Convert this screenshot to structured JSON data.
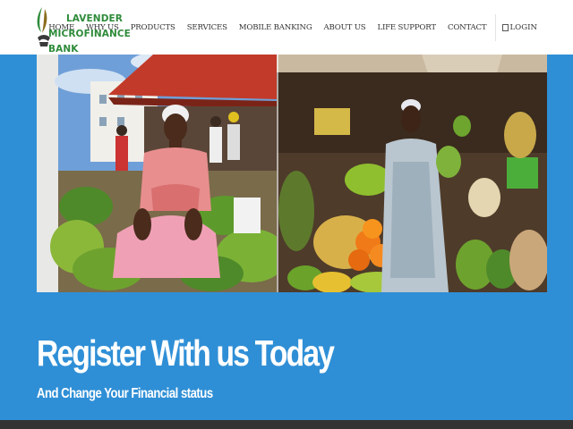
{
  "brand": {
    "name_line1": "LAVENDER",
    "name_line2": "MICROFINANCE BANK",
    "color": "#2e8b3a"
  },
  "nav": {
    "items": [
      "HOME",
      "WHY US",
      "PRODUCTS",
      "SERVICES",
      "MOBILE BANKING",
      "ABOUT US",
      "LIFE SUPPORT",
      "CONTACT"
    ],
    "login_label": "LOGIN",
    "login_icon": "login-icon"
  },
  "hero": {
    "image": "market-vendors-photo"
  },
  "tagline": {
    "title": "Register With us Today",
    "subtitle": "And Change Your Financial status"
  },
  "colors": {
    "accent": "#2f8fd6",
    "header_bg": "#ffffff",
    "footer_bg": "#333333"
  }
}
